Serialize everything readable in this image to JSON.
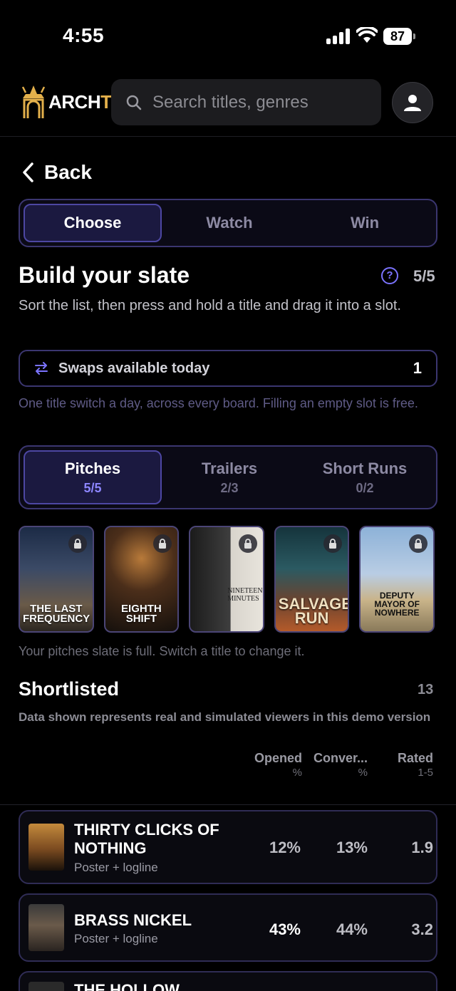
{
  "status_bar": {
    "time": "4:55",
    "battery": "87"
  },
  "header": {
    "logo_text_a": "ARCH",
    "logo_text_b": "TV",
    "search_placeholder": "Search titles, genres"
  },
  "nav": {
    "back_label": "Back"
  },
  "steps": [
    {
      "label": "Choose",
      "active": true
    },
    {
      "label": "Watch",
      "active": false
    },
    {
      "label": "Win",
      "active": false
    }
  ],
  "slate": {
    "title": "Build your slate",
    "help_glyph": "?",
    "count": "5/5",
    "description": "Sort the list, then press and hold a title and drag it into a slot.",
    "swaps_label": "Swaps available today",
    "swaps_count": "1",
    "swaps_note": "One title switch a day, across every board. Filling an empty slot is free."
  },
  "boards": [
    {
      "label": "Pitches",
      "count": "5/5",
      "active": true
    },
    {
      "label": "Trailers",
      "count": "2/3",
      "active": false
    },
    {
      "label": "Short Runs",
      "count": "0/2",
      "active": false
    }
  ],
  "posters": [
    {
      "title": "THE LAST FREQUENCY",
      "locked": true
    },
    {
      "title": "EIGHTH SHIFT",
      "locked": true
    },
    {
      "title": "NINETEEN MINUTES",
      "locked": true
    },
    {
      "title": "SALVAGE RUN",
      "locked": true
    },
    {
      "title": "DEPUTY MAYOR OF NOWHERE",
      "locked": true
    }
  ],
  "slate_full_msg": "Your pitches slate is full. Switch a title to change it.",
  "shortlist": {
    "title": "Shortlisted",
    "count": "13",
    "note": "Data shown represents real and simulated viewers in this demo version",
    "columns": [
      {
        "label": "Opened",
        "unit": "%"
      },
      {
        "label": "Conver...",
        "unit": "%"
      },
      {
        "label": "Rated",
        "unit": "1-5"
      }
    ],
    "rows": [
      {
        "title": "THIRTY CLICKS OF NOTHING",
        "sub": "Poster + logline",
        "opened": "12%",
        "conv": "13%",
        "rated": "1.9",
        "bold": false
      },
      {
        "title": "BRASS NICKEL",
        "sub": "Poster + logline",
        "opened": "43%",
        "conv": "44%",
        "rated": "3.2",
        "bold": true
      },
      {
        "title": "THE HOLLOW",
        "sub": "",
        "opened": "",
        "conv": "",
        "rated": "",
        "bold": false
      }
    ]
  }
}
